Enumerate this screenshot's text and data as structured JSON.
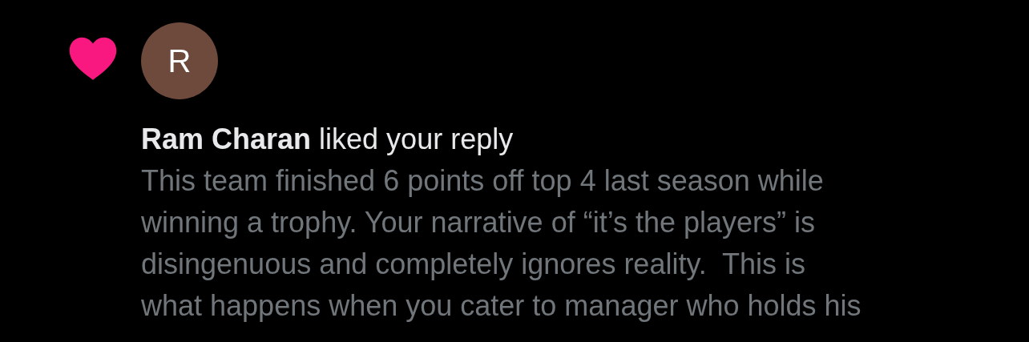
{
  "notification": {
    "avatar_letter": "R",
    "headline": "**Ram Charan** liked your reply",
    "reply_lines": [
      "This team finished 6 points off top 4 last season while",
      "winning a trophy. Your narrative of “it’s the players” is",
      "disingenuous and completely ignores reality.  This is",
      "what happens when you cater to manager who holds his"
    ]
  }
}
